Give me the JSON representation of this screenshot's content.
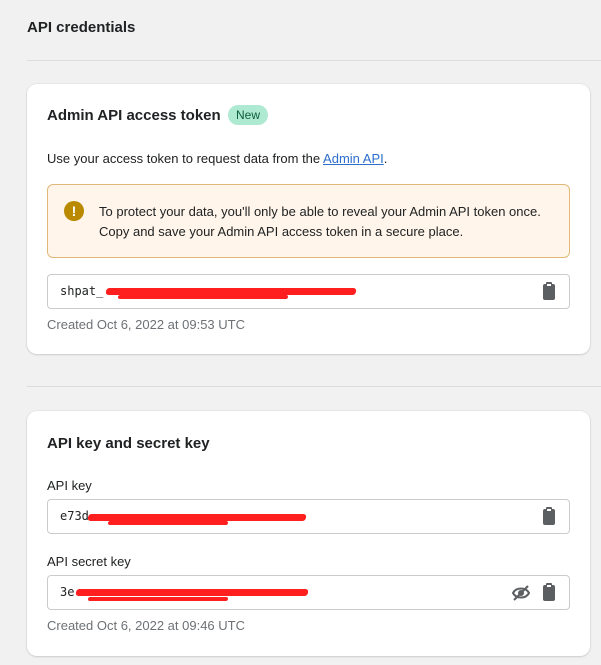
{
  "page": {
    "title": "API credentials"
  },
  "access_token_card": {
    "title": "Admin API access token",
    "badge": "New",
    "description_prefix": "Use your access token to request data from the ",
    "description_link": "Admin API",
    "description_suffix": ".",
    "banner": {
      "icon": "exclamation-circle-icon",
      "text": "To protect your data, you'll only be able to reveal your Admin API token once. Copy and save your Admin API access token in a secure place."
    },
    "token_value": "shpat_",
    "token_redacted": true,
    "copy_icon": "clipboard-icon",
    "created": "Created Oct 6, 2022 at 09:53 UTC"
  },
  "keys_card": {
    "title": "API key and secret key",
    "api_key_label": "API key",
    "api_key_value": "e73d",
    "api_secret_label": "API secret key",
    "api_secret_value": "3e",
    "hide_icon": "eye-slash-icon",
    "copy_icon": "clipboard-icon",
    "created": "Created Oct 6, 2022 at 09:46 UTC"
  },
  "colors": {
    "background": "#f1f1f1",
    "badge_bg": "#aee9d1",
    "banner_bg": "#fff5ea",
    "banner_border": "#e1b878",
    "warning_icon": "#b98900",
    "link": "#2c6ecb",
    "redaction": "#ff1f1f"
  }
}
